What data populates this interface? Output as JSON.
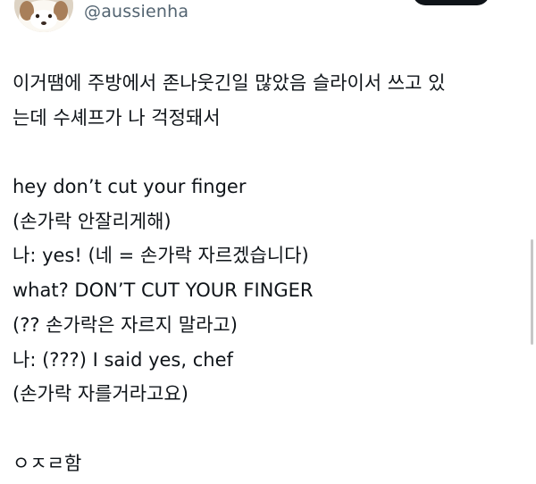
{
  "tweet": {
    "handle": "@aussienha",
    "lines": [
      "이거땜에 주방에서 존나웃긴일 많았음 슬라이서 쓰고 있",
      "는데 수셰프가 나 걱정돼서",
      "",
      "hey don’t cut your finger",
      "(손가락 안잘리게해)",
      "나: yes! (네 = 손가락 자르겠습니다)",
      "what? DON’T CUT YOUR FINGER",
      "(?? 손가락은 자르지 말라고)",
      "나: (???) I said yes, chef",
      "(손가락 자를거라고요)",
      "",
      "ㅇㅈㄹ함"
    ]
  },
  "colors": {
    "text": "#0f1419",
    "handle": "#536471",
    "button": "#0f1419",
    "scrollbar": "#c7c7c7"
  },
  "icons": {
    "avatar": "profile-avatar"
  }
}
